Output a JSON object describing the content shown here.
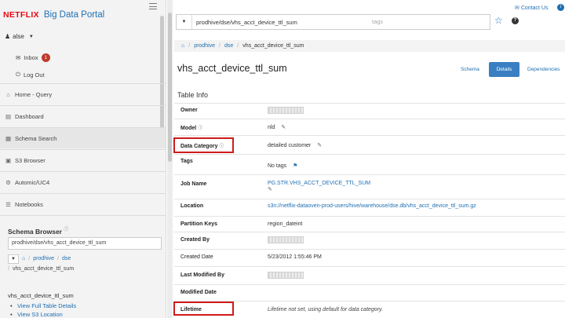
{
  "brand": {
    "logo": "NETFLIX",
    "title": "Big Data Portal"
  },
  "user": {
    "name": "alse"
  },
  "user_menu": {
    "inbox": "Inbox",
    "inbox_count": "1",
    "logout": "Log Out"
  },
  "nav": {
    "items": [
      {
        "label": "Home - Query",
        "icon": "home-icon"
      },
      {
        "label": "Dashboard",
        "icon": "dashboard-icon"
      },
      {
        "label": "Schema Search",
        "icon": "table-icon"
      },
      {
        "label": "S3 Browser",
        "icon": "folder-icon"
      },
      {
        "label": "Automic/UC4",
        "icon": "gear-icon"
      },
      {
        "label": "Notebooks",
        "icon": "notebook-icon"
      }
    ]
  },
  "schema_browser": {
    "heading": "Schema Browser",
    "input_value": "prodhive/dse/vhs_acct_device_ttl_sum",
    "crumbs": [
      "prodhive",
      "dse"
    ],
    "crumb2": "vhs_acct_device_ttl_sum",
    "table_name": "vhs_acct_device_ttl_sum",
    "links": [
      "View Full Table Details",
      "View S3 Location"
    ]
  },
  "topbar": {
    "contact": "Contact Us",
    "search_value": "prodhive/dse/vhs_acct_device_ttl_sum",
    "tags_placeholder": "tags"
  },
  "breadcrumb": {
    "items": [
      "prodhive",
      "dse"
    ],
    "current": "vhs_acct_device_ttl_sum"
  },
  "page": {
    "title": "vhs_acct_device_ttl_sum",
    "tabs": {
      "schema": "Schema",
      "details": "Details",
      "dependencies": "Dependencies"
    },
    "section": "Table Info"
  },
  "table_info": {
    "owner_label": "Owner",
    "model_label": "Model",
    "model_value": "nld",
    "data_category_label": "Data Category",
    "data_category_value": "detailed customer",
    "tags_label": "Tags",
    "tags_value": "No tags",
    "job_name_label": "Job Name",
    "job_name_value": "PG.STR.VHS_ACCT_DEVICE_TTL_SUM",
    "location_label": "Location",
    "location_value": "s3n://netflix-dataoven-prod-users/hive/warehouse/dse.db/vhs_acct_device_ttl_sum.gz",
    "partition_keys_label": "Partition Keys",
    "partition_keys_value": "region_dateint",
    "created_by_label": "Created By",
    "created_date_label": "Created Date",
    "created_date_value": "5/23/2012 1:55:46 PM",
    "last_modified_by_label": "Last Modified By",
    "modified_date_label": "Modified Date",
    "lifetime_label": "Lifetime",
    "lifetime_value": "Lifetime not set, using default for data category."
  },
  "colors": {
    "highlight": "#d01a1a",
    "accent": "#1f6fb2",
    "brand": "#e50914"
  }
}
